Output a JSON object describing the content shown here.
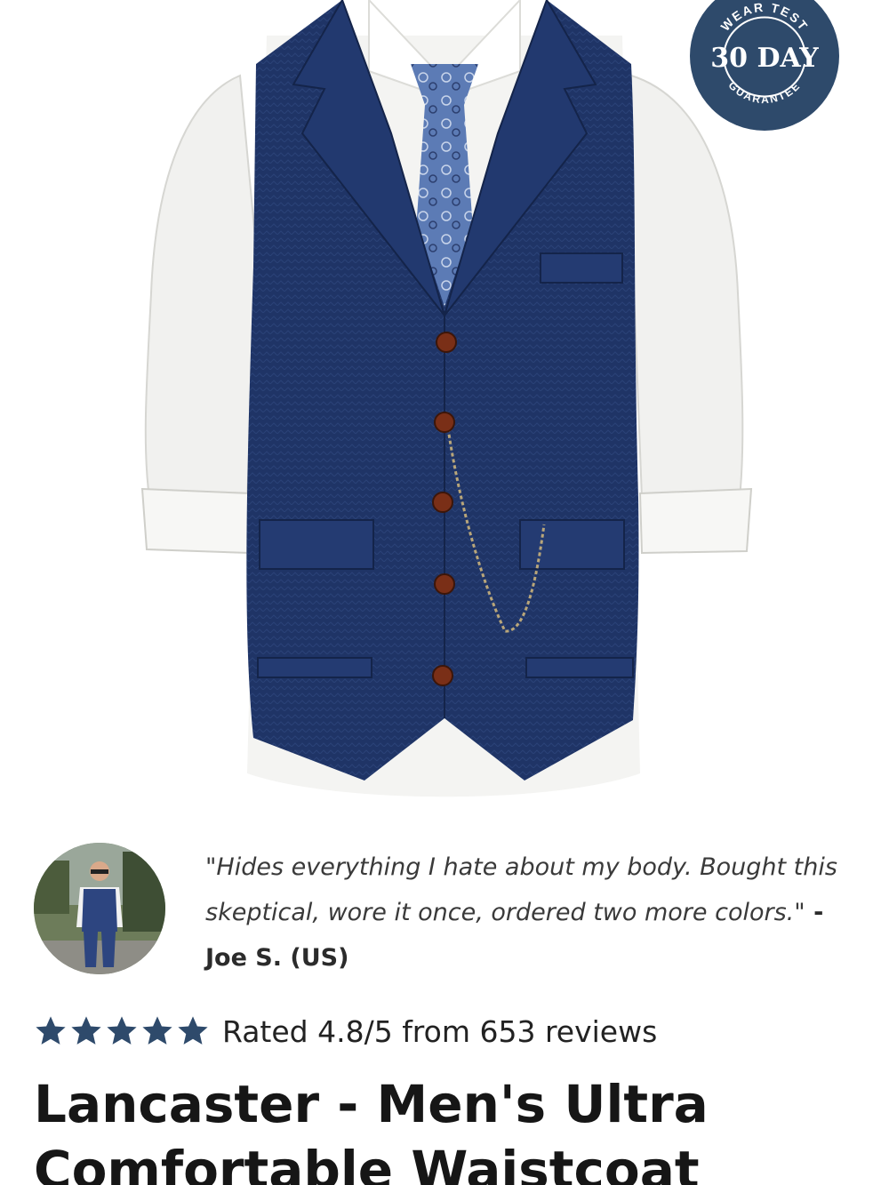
{
  "badge": {
    "top_text": "WEAR TEST",
    "main_text": "30 DAY",
    "bottom_text": "GUARANTEE",
    "color": "#2e4a6b"
  },
  "review": {
    "quote": "\"Hides everything I hate about my body. Bought this skeptical, wore it once, ordered two more colors.\"",
    "author": " - Joe S. (US)"
  },
  "rating": {
    "stars": 5,
    "star_color": "#2e4a6b",
    "text": "Rated 4.8/5 from 653 reviews"
  },
  "product": {
    "title": "Lancaster - Men's Ultra Comfortable Waistcoat"
  },
  "colors": {
    "vest": "#1f3466",
    "shirt": "#f4f4f2",
    "tie": "#5c7bb5",
    "button": "#7a2f17",
    "chain": "#b9a67a"
  }
}
